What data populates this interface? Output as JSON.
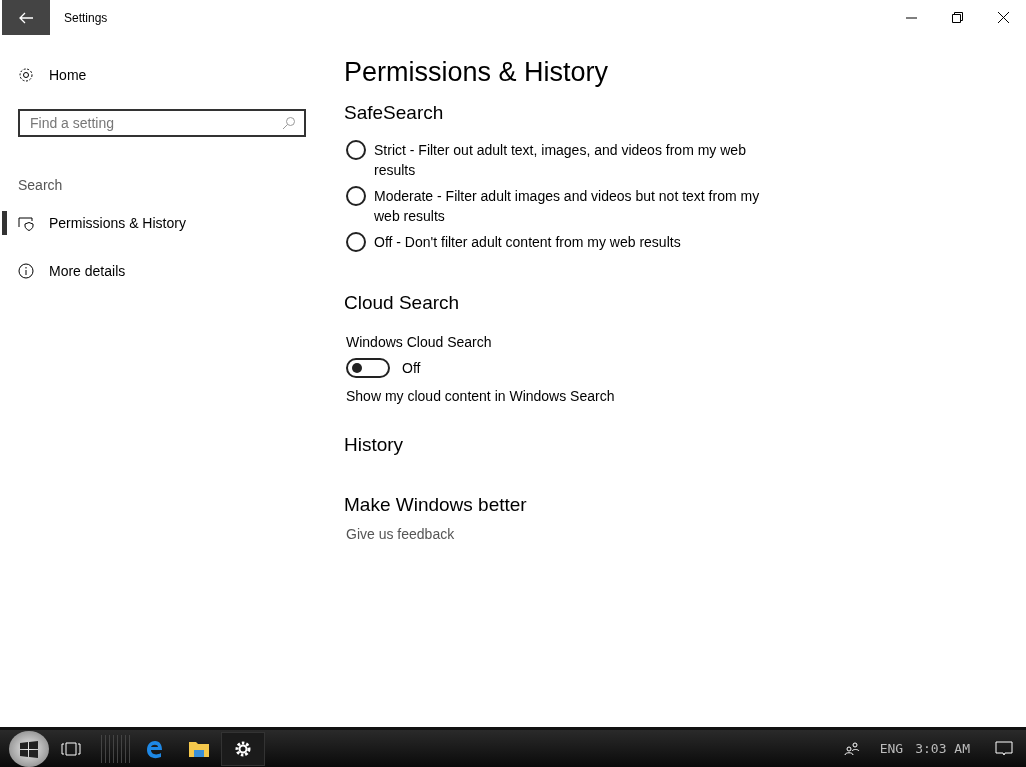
{
  "window": {
    "title": "Settings"
  },
  "sidebar": {
    "home": "Home",
    "search": {
      "placeholder": "Find a setting"
    },
    "section": "Search",
    "items": [
      {
        "label": "Permissions & History",
        "kind": "shield",
        "selected": true
      },
      {
        "label": "More details",
        "kind": "info",
        "selected": false
      }
    ]
  },
  "page": {
    "title": "Permissions & History",
    "safesearch": {
      "heading": "SafeSearch",
      "options": [
        {
          "label": "Strict - Filter out adult text, images, and videos from my web results",
          "selected": false
        },
        {
          "label": "Moderate - Filter adult images and videos but not text from my web results",
          "selected": false
        },
        {
          "label": "Off - Don't filter adult content from my web results",
          "selected": false
        }
      ]
    },
    "cloud": {
      "heading": "Cloud Search",
      "label": "Windows Cloud Search",
      "toggle": {
        "on": false,
        "text": "Off"
      },
      "description": "Show my cloud content in Windows Search"
    },
    "history": {
      "heading": "History"
    },
    "better": {
      "heading": "Make Windows better",
      "link": "Give us feedback"
    }
  },
  "taskbar": {
    "apps": [
      {
        "kind": "edge",
        "selected": false
      },
      {
        "kind": "folder",
        "selected": false
      },
      {
        "kind": "settings",
        "selected": true
      }
    ],
    "language": "ENG",
    "time": "3:03 AM"
  }
}
